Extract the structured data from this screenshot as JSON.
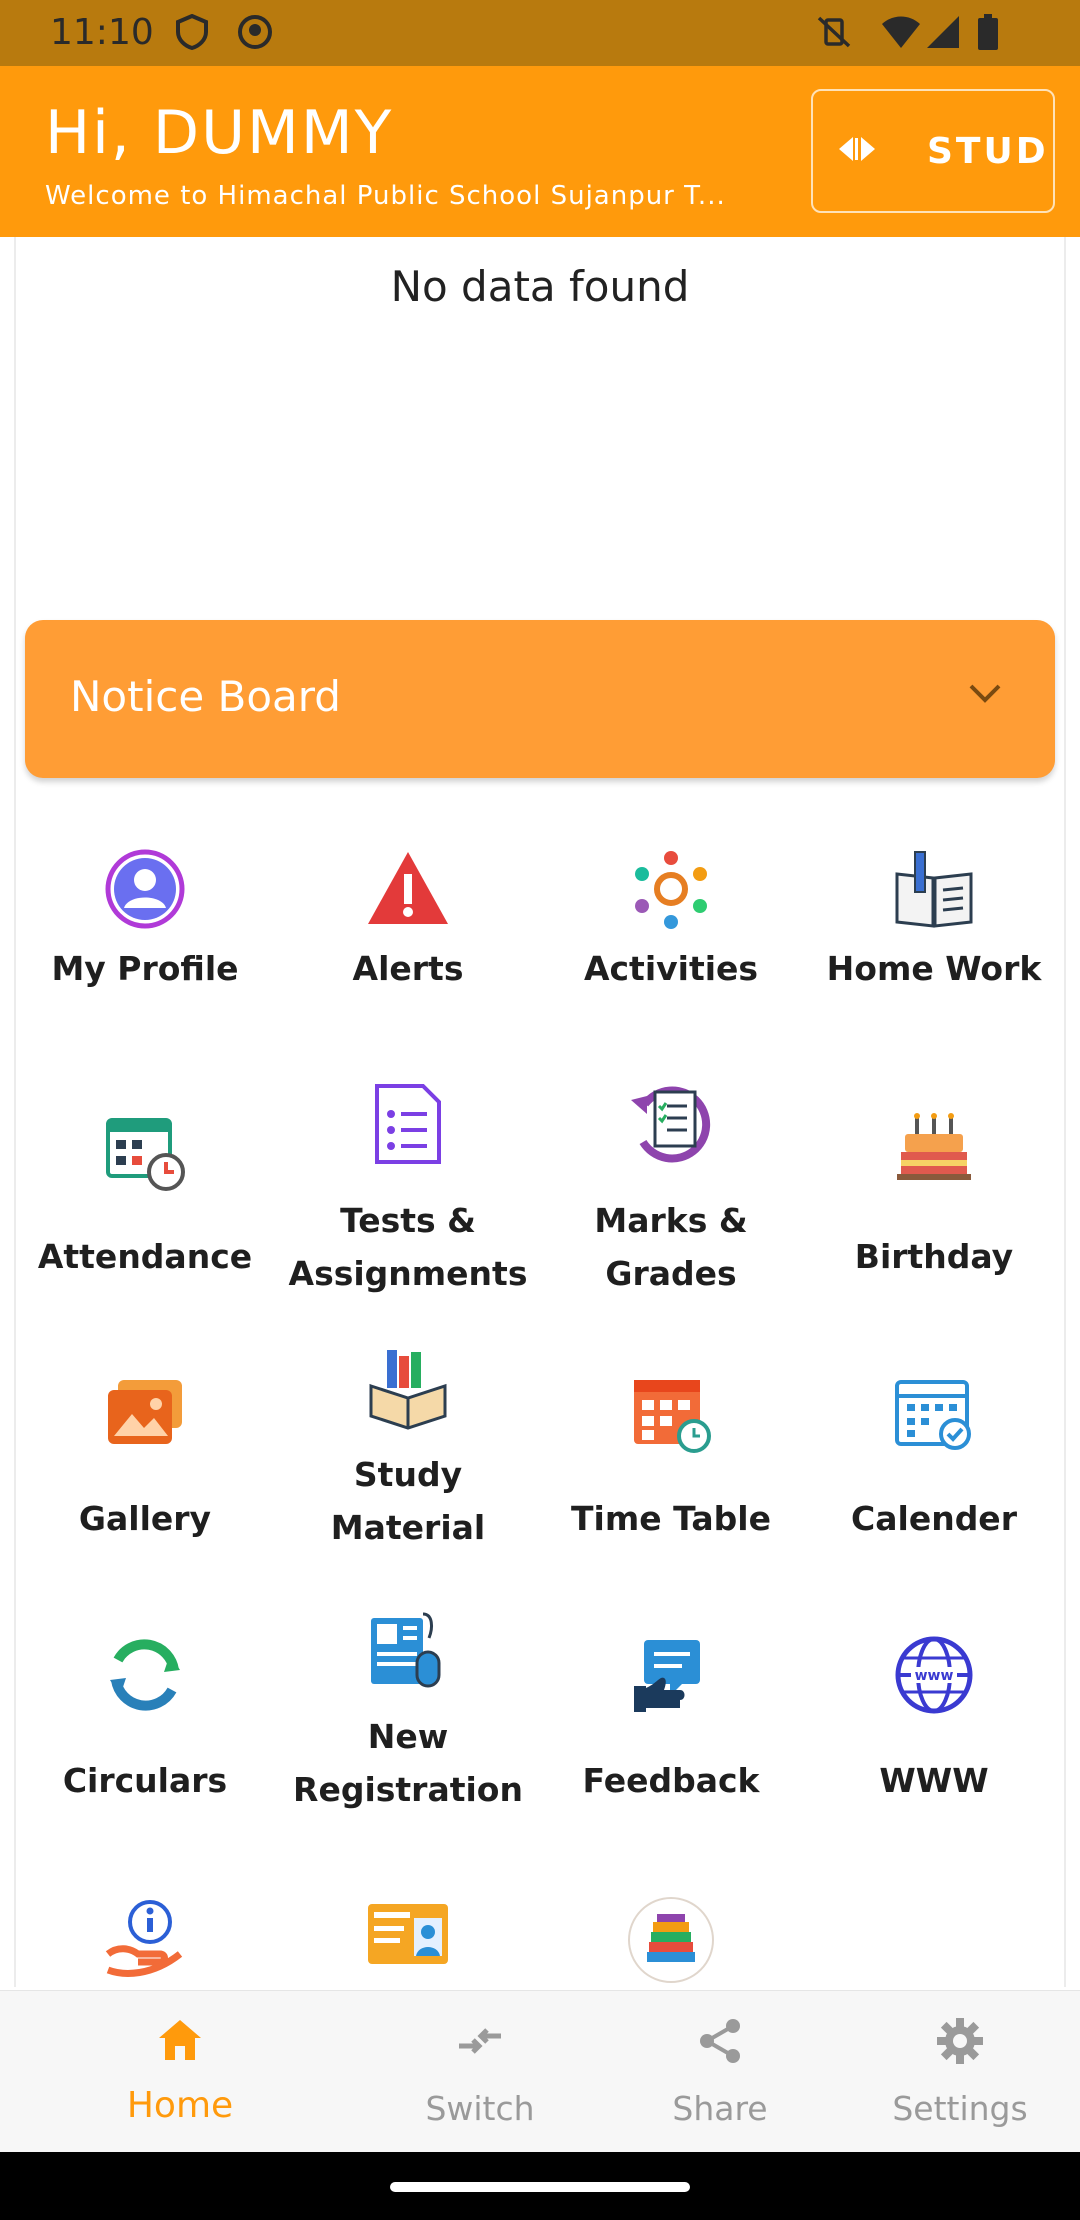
{
  "status_bar": {
    "time": "11:10"
  },
  "header": {
    "greeting": "Hi, DUMMY",
    "welcome": "Welcome to Himachal Public School Sujanpur T...",
    "role_button": "STUD"
  },
  "content": {
    "empty_message": "No data found"
  },
  "notice_board": {
    "title": "Notice Board"
  },
  "menu": {
    "items": [
      {
        "label": "My Profile",
        "icon": "profile-icon"
      },
      {
        "label": "Alerts",
        "icon": "alert-icon"
      },
      {
        "label": "Activities",
        "icon": "activities-icon"
      },
      {
        "label": "Home Work",
        "icon": "homework-icon"
      },
      {
        "label": "Attendance",
        "icon": "attendance-icon"
      },
      {
        "label": "Tests & Assignments",
        "icon": "tests-icon"
      },
      {
        "label": "Marks & Grades",
        "icon": "marks-icon"
      },
      {
        "label": "Birthday",
        "icon": "birthday-cake-icon"
      },
      {
        "label": "Gallery",
        "icon": "gallery-icon"
      },
      {
        "label": "Study Material",
        "icon": "study-material-icon"
      },
      {
        "label": "Time Table",
        "icon": "timetable-icon"
      },
      {
        "label": "Calender",
        "icon": "calendar-icon"
      },
      {
        "label": "Circulars",
        "icon": "circulars-icon"
      },
      {
        "label": "New Registration",
        "icon": "registration-icon"
      },
      {
        "label": "Feedback",
        "icon": "feedback-icon"
      },
      {
        "label": "WWW",
        "icon": "globe-icon"
      },
      {
        "label": "",
        "icon": "help-info-icon"
      },
      {
        "label": "",
        "icon": "id-card-icon"
      },
      {
        "label": "",
        "icon": "books-icon"
      }
    ]
  },
  "bottom_nav": {
    "items": [
      {
        "label": "Home",
        "icon": "home-icon",
        "active": true
      },
      {
        "label": "Switch",
        "icon": "switch-icon",
        "active": false
      },
      {
        "label": "Share",
        "icon": "share-icon",
        "active": false
      },
      {
        "label": "Settings",
        "icon": "settings-icon",
        "active": false
      }
    ]
  },
  "colors": {
    "header": "#FF9A0C",
    "notice": "#FF9D35",
    "status_bar": "#B87A0E",
    "nav_active": "#FF9A0C",
    "nav_inactive": "#9A9A9A"
  }
}
